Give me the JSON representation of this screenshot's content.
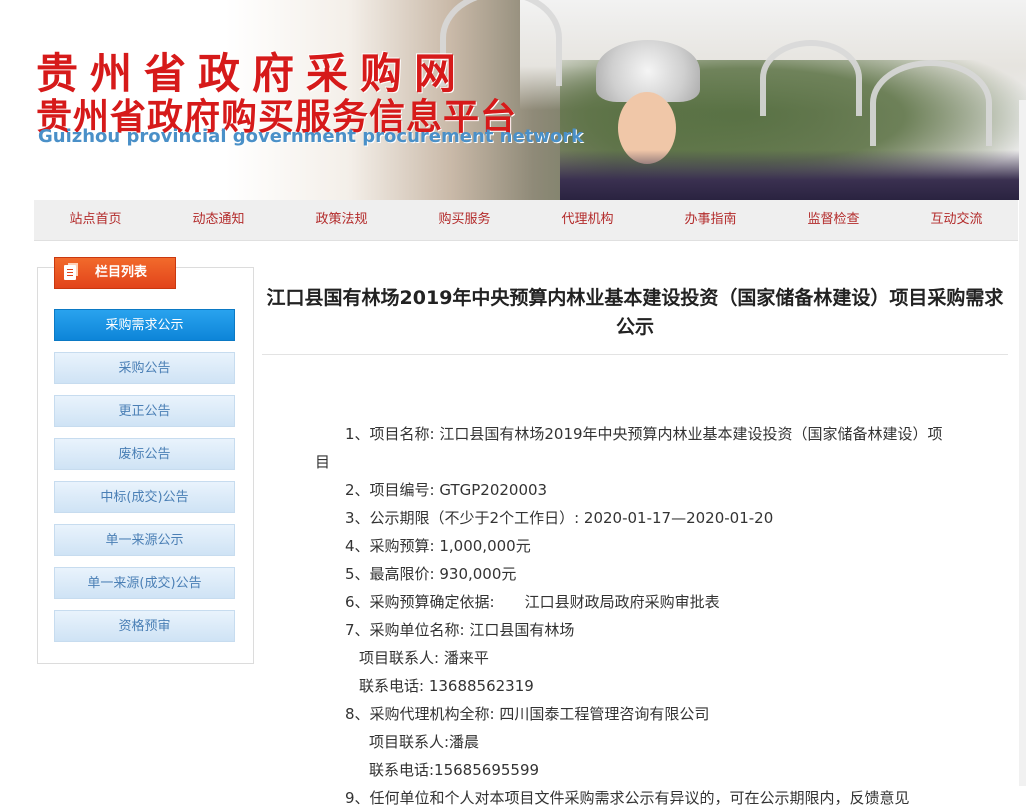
{
  "banner": {
    "title_line1": "贵州省政府采购网",
    "title_line2": "贵州省政府购买服务信息平台",
    "title_en": "Guizhou provincial government procurement network",
    "brand_color": "#d61a1a"
  },
  "nav": {
    "items": [
      "站点首页",
      "动态通知",
      "政策法规",
      "购买服务",
      "代理机构",
      "办事指南",
      "监督检查",
      "互动交流"
    ]
  },
  "sidebar": {
    "header": "栏目列表",
    "items": [
      {
        "label": "采购需求公示",
        "active": true
      },
      {
        "label": "采购公告",
        "active": false
      },
      {
        "label": "更正公告",
        "active": false
      },
      {
        "label": "废标公告",
        "active": false
      },
      {
        "label": "中标(成交)公告",
        "active": false
      },
      {
        "label": "单一来源公示",
        "active": false
      },
      {
        "label": "单一来源(成交)公告",
        "active": false
      },
      {
        "label": "资格预审",
        "active": false
      }
    ]
  },
  "article": {
    "title": "江口县国有林场2019年中央预算内林业基本建设投资（国家储备林建设）项目采购需求公示",
    "lines": [
      "1、项目名称: 江口县国有林场2019年中央预算内林业基本建设投资（国家储备林建设）项目",
      "2、项目编号: GTGP2020003",
      "3、公示期限（不少于2个工作日）: 2020-01-17—2020-01-20",
      "4、采购预算: 1,000,000元",
      "5、最高限价: 930,000元",
      "6、采购预算确定依据:　　江口县财政局政府采购审批表",
      "7、采购单位名称: 江口县国有林场",
      "项目联系人: 潘来平",
      "联系电话: 13688562319",
      "8、采购代理机构全称: 四川国泰工程管理咨询有限公司",
      "项目联系人:潘晨",
      "联系电话:15685695599",
      "9、任何单位和个人对本项目文件采购需求公示有异议的，可在公示期限内，反馈意见"
    ]
  }
}
